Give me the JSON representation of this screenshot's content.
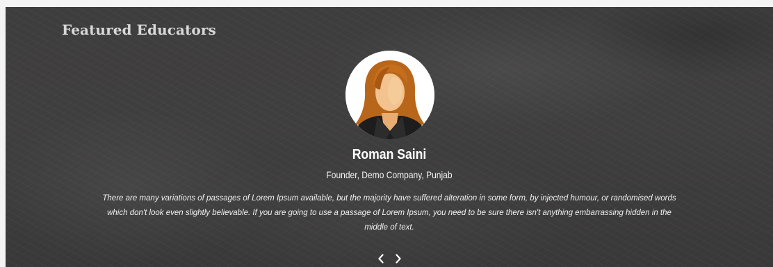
{
  "section": {
    "title": "Featured Educators"
  },
  "educator": {
    "name": "Roman Saini",
    "role": "Founder, Demo Company, Punjab",
    "quote": "There are many variations of passages of Lorem Ipsum available, but the majority have suffered alteration in some form, by injected humour, or randomised words which don't look even slightly believable. If you are going to use a passage of Lorem Ipsum, you need to be sure there isn't anything embarrassing hidden in the middle of text."
  },
  "carousel": {
    "prev_icon": "chevron-left-icon",
    "next_icon": "chevron-right-icon"
  },
  "colors": {
    "board": "#3f3e3e",
    "title": "#d8d8d8",
    "text": "#ffffff",
    "hair": "#b8661a",
    "skin": "#f2c38e",
    "jacket": "#1d1d1d"
  }
}
